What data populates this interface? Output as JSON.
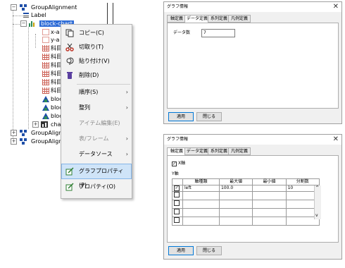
{
  "tree": {
    "root": "GroupAlignment",
    "label": "Label",
    "selected": "block-chart",
    "xaxis": "x-a",
    "yaxis": "y-a",
    "items": [
      "科目",
      "科目",
      "科目",
      "科目",
      "科目",
      "科目"
    ],
    "blocks": [
      "bloc",
      "bloc",
      "bloc"
    ],
    "chart": "cha",
    "group2": "GroupAligne",
    "group3": "GroupAligne"
  },
  "context_menu": {
    "items": [
      {
        "label": "コピー(C)",
        "icon": "copy-icon",
        "enabled": true
      },
      {
        "label": "切取り(T)",
        "icon": "scissors-icon",
        "enabled": true
      },
      {
        "label": "貼り付け(V)",
        "icon": "paste-icon",
        "enabled": true
      },
      {
        "label": "削除(D)",
        "icon": "trash-icon",
        "enabled": true
      },
      {
        "label": "順序(S)",
        "submenu": true,
        "enabled": true
      },
      {
        "label": "整列",
        "submenu": true,
        "enabled": true
      },
      {
        "label": "アイテム編集(E)",
        "enabled": false
      },
      {
        "label": "表/フレーム",
        "submenu": true,
        "enabled": false
      },
      {
        "label": "データソース",
        "submenu": true,
        "enabled": true
      },
      {
        "label": "グラフプロパティ(P)",
        "icon": "chart-properties-icon",
        "enabled": true,
        "highlighted": true
      },
      {
        "label": "プロパティ(O)",
        "icon": "properties-icon",
        "enabled": true
      }
    ]
  },
  "dialog1": {
    "title": "グラフ情報",
    "close": "✕",
    "tabs": [
      "軸定義",
      "データ定義",
      "系列定義",
      "凡例定義"
    ],
    "active_tab": 1,
    "field_label": "データ数",
    "field_value": "7",
    "ok": "適用",
    "close_btn": "閉じる"
  },
  "dialog2": {
    "title": "グラフ情報",
    "close": "✕",
    "tabs": [
      "軸定義",
      "データ定義",
      "系列定義",
      "凡例定義"
    ],
    "active_tab": 0,
    "xaxis_check": "X軸",
    "y_label": "Y軸",
    "headers": [
      "軸種類",
      "最大値",
      "最小値",
      "分割数"
    ],
    "rows": [
      {
        "checked": true,
        "type": "left",
        "max": "100.0",
        "min": "",
        "div": "10"
      },
      {
        "checked": false,
        "type": "",
        "max": "",
        "min": "",
        "div": ""
      },
      {
        "checked": false,
        "type": "",
        "max": "",
        "min": "",
        "div": ""
      },
      {
        "checked": false,
        "type": "",
        "max": "",
        "min": "",
        "div": ""
      },
      {
        "checked": false,
        "type": "",
        "max": "",
        "min": "",
        "div": ""
      }
    ],
    "scroll_up": "^",
    "scroll_down": "v",
    "ok": "適用",
    "close_btn": "閉じる"
  }
}
